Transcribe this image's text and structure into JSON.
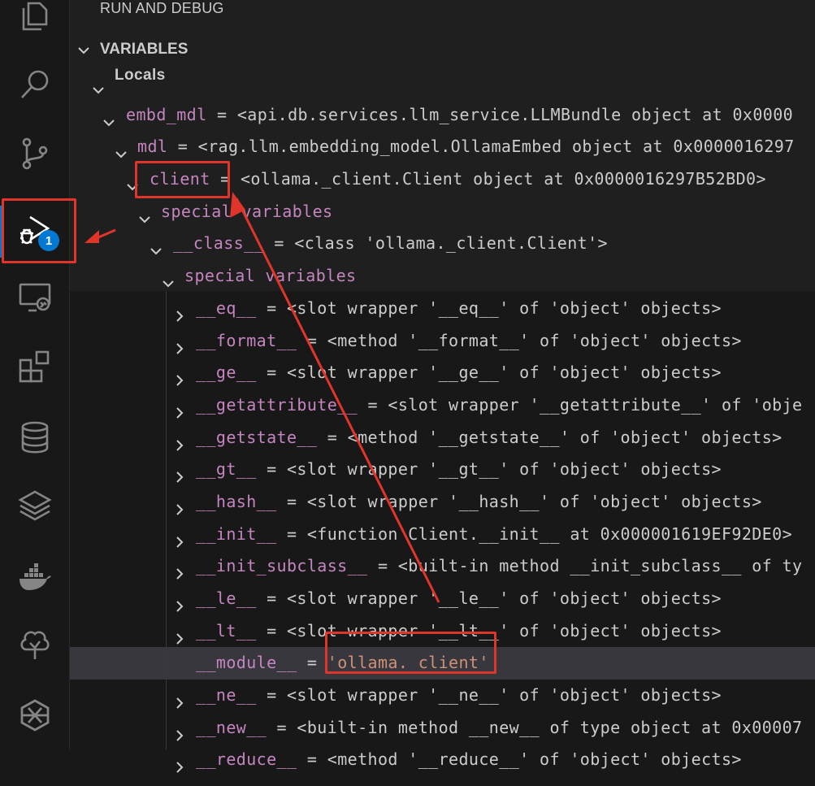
{
  "activity_bar": {
    "items": [
      {
        "icon": "files-icon"
      },
      {
        "icon": "search-icon"
      },
      {
        "icon": "source-control-icon"
      },
      {
        "icon": "run-debug-icon",
        "active": true,
        "badge": "1"
      },
      {
        "icon": "remote-explorer-icon"
      },
      {
        "icon": "extensions-icon"
      },
      {
        "icon": "database-icon"
      },
      {
        "icon": "layers-icon"
      },
      {
        "icon": "docker-icon"
      },
      {
        "icon": "tree-icon"
      },
      {
        "icon": "openai-icon"
      }
    ]
  },
  "panel": {
    "title": "RUN AND DEBUG",
    "section": "VARIABLES",
    "scope": "Locals"
  },
  "variables": [
    {
      "name": "embd_mdl",
      "value": "<api.db.services.llm_service.LLMBundle object at 0x0000"
    },
    {
      "name": "mdl",
      "value": "<rag.llm.embedding_model.OllamaEmbed object at 0x0000016297"
    },
    {
      "name": "client",
      "value": "<ollama._client.Client object at 0x0000016297B52BD0>"
    },
    {
      "name": "special variables",
      "value": ""
    },
    {
      "name": "__class__",
      "value": "<class 'ollama._client.Client'>"
    },
    {
      "name": "special variables",
      "value": ""
    },
    {
      "name": "__eq__",
      "value": "<slot wrapper '__eq__' of 'object' objects>"
    },
    {
      "name": "__format__",
      "value": "<method '__format__' of 'object' objects>"
    },
    {
      "name": "__ge__",
      "value": "<slot wrapper '__ge__' of 'object' objects>"
    },
    {
      "name": "__getattribute__",
      "value": "<slot wrapper '__getattribute__' of 'obje"
    },
    {
      "name": "__getstate__",
      "value": "<method '__getstate__' of 'object' objects>"
    },
    {
      "name": "__gt__",
      "value": "<slot wrapper '__gt__' of 'object' objects>"
    },
    {
      "name": "__hash__",
      "value": "<slot wrapper '__hash__' of 'object' objects>"
    },
    {
      "name": "__init__",
      "value": "<function Client.__init__ at 0x000001619EF92DE0>"
    },
    {
      "name": "__init_subclass__",
      "value": "<built-in method __init_subclass__ of ty"
    },
    {
      "name": "__le__",
      "value": "<slot wrapper '__le__' of 'object' objects>"
    },
    {
      "name": "__lt__",
      "value": "<slot wrapper '__lt__' of 'object' objects>"
    },
    {
      "name": "__module__",
      "value": "'ollama._client'"
    },
    {
      "name": "__ne__",
      "value": "<slot wrapper '__ne__' of 'object' objects>"
    },
    {
      "name": "__new__",
      "value": "<built-in method __new__ of type object at 0x00007"
    },
    {
      "name": "__reduce__",
      "value": "<method '__reduce__' of 'object' objects>"
    }
  ],
  "colors": {
    "accent": "#0078d4",
    "annotation": "#e0352b",
    "variable_name": "#c586c0",
    "string_value": "#ce9178"
  }
}
